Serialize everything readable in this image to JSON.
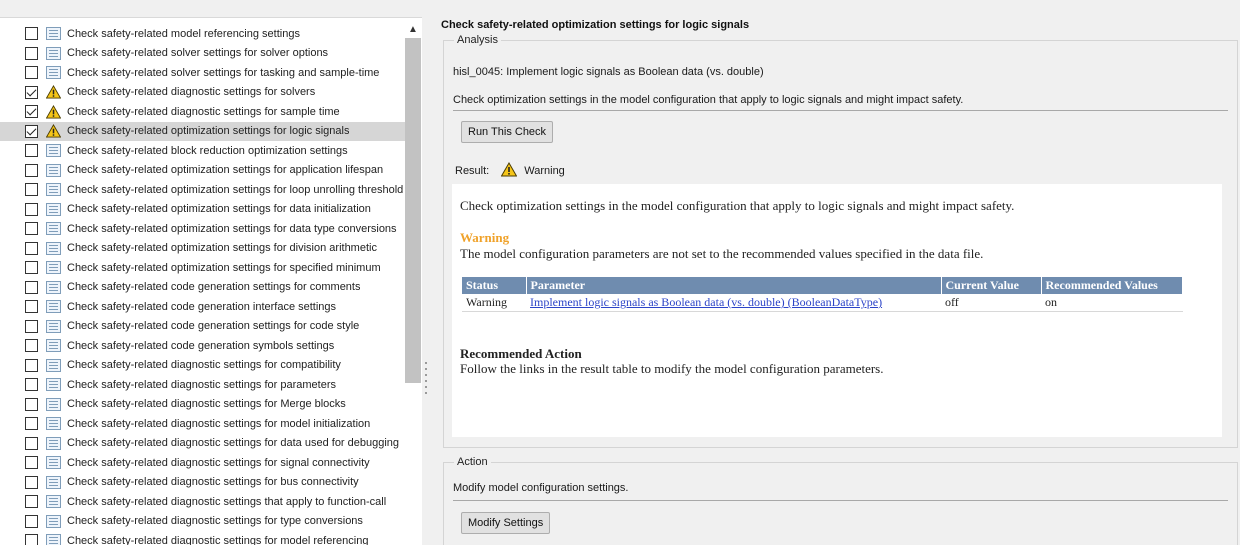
{
  "tree": {
    "items": [
      {
        "label": "Check safety-related model referencing settings",
        "checked": false,
        "icon": "list-icon",
        "selected": false
      },
      {
        "label": "Check safety-related solver settings for solver options",
        "checked": false,
        "icon": "list-icon",
        "selected": false
      },
      {
        "label": "Check safety-related solver settings for tasking and sample-time",
        "checked": false,
        "icon": "list-icon",
        "selected": false
      },
      {
        "label": "Check safety-related diagnostic settings for solvers",
        "checked": true,
        "icon": "warning-icon",
        "selected": false
      },
      {
        "label": "Check safety-related diagnostic settings for sample time",
        "checked": true,
        "icon": "warning-icon",
        "selected": false
      },
      {
        "label": "Check safety-related optimization settings for logic signals",
        "checked": true,
        "icon": "warning-icon",
        "selected": true
      },
      {
        "label": "Check safety-related block reduction optimization settings",
        "checked": false,
        "icon": "list-icon",
        "selected": false
      },
      {
        "label": "Check safety-related optimization settings for application lifespan",
        "checked": false,
        "icon": "list-icon",
        "selected": false
      },
      {
        "label": "Check safety-related optimization settings for loop unrolling threshold",
        "checked": false,
        "icon": "list-icon",
        "selected": false
      },
      {
        "label": "Check safety-related optimization settings for data initialization",
        "checked": false,
        "icon": "list-icon",
        "selected": false
      },
      {
        "label": "Check safety-related optimization settings for data type conversions",
        "checked": false,
        "icon": "list-icon",
        "selected": false
      },
      {
        "label": "Check safety-related optimization settings for division arithmetic",
        "checked": false,
        "icon": "list-icon",
        "selected": false
      },
      {
        "label": "Check safety-related optimization settings for specified minimum",
        "checked": false,
        "icon": "list-icon",
        "selected": false
      },
      {
        "label": "Check safety-related code generation settings for comments",
        "checked": false,
        "icon": "list-icon",
        "selected": false
      },
      {
        "label": "Check safety-related code generation interface settings",
        "checked": false,
        "icon": "list-icon",
        "selected": false
      },
      {
        "label": "Check safety-related code generation settings for code style",
        "checked": false,
        "icon": "list-icon",
        "selected": false
      },
      {
        "label": "Check safety-related code generation symbols settings",
        "checked": false,
        "icon": "list-icon",
        "selected": false
      },
      {
        "label": "Check safety-related diagnostic settings for compatibility",
        "checked": false,
        "icon": "list-icon",
        "selected": false
      },
      {
        "label": "Check safety-related diagnostic settings for parameters",
        "checked": false,
        "icon": "list-icon",
        "selected": false
      },
      {
        "label": "Check safety-related diagnostic settings for Merge blocks",
        "checked": false,
        "icon": "list-icon",
        "selected": false
      },
      {
        "label": "Check safety-related diagnostic settings for model initialization",
        "checked": false,
        "icon": "list-icon",
        "selected": false
      },
      {
        "label": "Check safety-related diagnostic settings for data used for debugging",
        "checked": false,
        "icon": "list-icon",
        "selected": false
      },
      {
        "label": "Check safety-related diagnostic settings for signal connectivity",
        "checked": false,
        "icon": "list-icon",
        "selected": false
      },
      {
        "label": "Check safety-related diagnostic settings for bus connectivity",
        "checked": false,
        "icon": "list-icon",
        "selected": false
      },
      {
        "label": "Check safety-related diagnostic settings that apply to function-call",
        "checked": false,
        "icon": "list-icon",
        "selected": false
      },
      {
        "label": "Check safety-related diagnostic settings for type conversions",
        "checked": false,
        "icon": "list-icon",
        "selected": false
      },
      {
        "label": "Check safety-related diagnostic settings for model referencing",
        "checked": false,
        "icon": "list-icon",
        "selected": false
      }
    ]
  },
  "detail": {
    "title": "Check safety-related optimization settings for logic signals",
    "analysis": {
      "legend": "Analysis",
      "check_id": "hisl_0045: Implement logic signals as Boolean data (vs. double)",
      "description": "Check optimization settings in the model configuration that apply to logic signals and might impact safety.",
      "run_button": "Run This Check",
      "result_label": "Result:",
      "result_value": "Warning"
    },
    "report": {
      "description": "Check optimization settings in the model configuration that apply to logic signals and might impact safety.",
      "warning_heading": "Warning",
      "warning_text": "The model configuration parameters are not set to the recommended values specified in the data file.",
      "table": {
        "headers": [
          "Status",
          "Parameter",
          "Current Value",
          "Recommended Values"
        ],
        "rows": [
          {
            "status": "Warning",
            "parameter": "Implement logic signals as Boolean data (vs. double) (BooleanDataType)",
            "current": "off",
            "recommended": "on"
          }
        ]
      },
      "recommended_heading": "Recommended Action",
      "recommended_text": "Follow the links in the result table to modify the model configuration parameters."
    },
    "action": {
      "legend": "Action",
      "description": "Modify model configuration settings.",
      "button": "Modify Settings"
    }
  },
  "colors": {
    "warning_heading": "#f0a22a",
    "table_header": "#6f8caf",
    "link": "#2c44c8",
    "selected_row": "#d6d6d6"
  }
}
